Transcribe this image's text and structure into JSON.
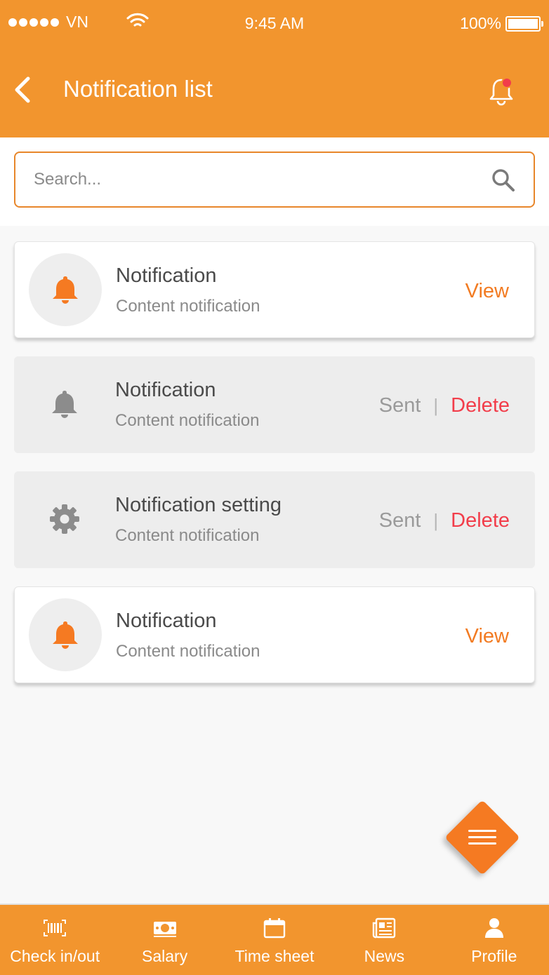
{
  "status_bar": {
    "carrier": "VN",
    "time": "9:45 AM",
    "battery": "100%"
  },
  "header": {
    "title": "Notification list"
  },
  "search": {
    "placeholder": "Search..."
  },
  "notifications": [
    {
      "title": "Notification",
      "subtitle": "Content notification",
      "action": "View"
    },
    {
      "title": "Notification",
      "subtitle": "Content notification",
      "sent": "Sent",
      "separator": "|",
      "delete": "Delete"
    },
    {
      "title": "Notification setting",
      "subtitle": "Content notification",
      "sent": "Sent",
      "separator": "|",
      "delete": "Delete"
    },
    {
      "title": "Notification",
      "subtitle": "Content notification",
      "action": "View"
    }
  ],
  "tabs": [
    {
      "label": "Check in/out",
      "icon": "barcode-icon"
    },
    {
      "label": "Salary",
      "icon": "money-icon"
    },
    {
      "label": "Time sheet",
      "icon": "calendar-icon"
    },
    {
      "label": "News",
      "icon": "newspaper-icon"
    },
    {
      "label": "Profile",
      "icon": "user-icon"
    }
  ],
  "colors": {
    "primary": "#f2952e",
    "accent": "#f27b22",
    "danger": "#f23d4a",
    "muted_bg": "#ededed"
  }
}
